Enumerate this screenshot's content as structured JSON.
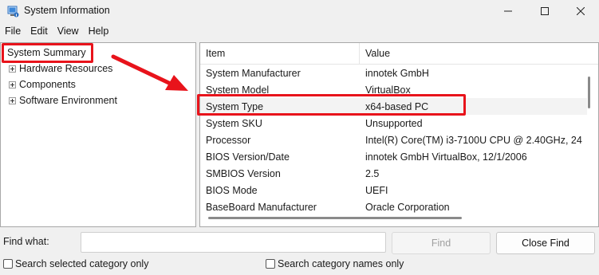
{
  "window": {
    "title": "System Information"
  },
  "menu": [
    "File",
    "Edit",
    "View",
    "Help"
  ],
  "tree": {
    "root": "System Summary",
    "children": [
      "Hardware Resources",
      "Components",
      "Software Environment"
    ]
  },
  "list": {
    "header_item": "Item",
    "header_value": "Value",
    "rows": [
      {
        "item": "System Manufacturer",
        "value": "innotek GmbH"
      },
      {
        "item": "System Model",
        "value": "VirtualBox"
      },
      {
        "item": "System Type",
        "value": "x64-based PC"
      },
      {
        "item": "System SKU",
        "value": "Unsupported"
      },
      {
        "item": "Processor",
        "value": "Intel(R) Core(TM) i3-7100U CPU @ 2.40GHz, 24"
      },
      {
        "item": "BIOS Version/Date",
        "value": "innotek GmbH VirtualBox, 12/1/2006"
      },
      {
        "item": "SMBIOS Version",
        "value": "2.5"
      },
      {
        "item": "BIOS Mode",
        "value": "UEFI"
      },
      {
        "item": "BaseBoard Manufacturer",
        "value": "Oracle Corporation"
      }
    ]
  },
  "find": {
    "label": "Find what:",
    "value": "",
    "find_button": "Find",
    "close_button": "Close Find",
    "check_selected": "Search selected category only",
    "check_names": "Search category names only"
  },
  "colors": {
    "annotation": "#e8131b",
    "background": "#f0f0f0"
  },
  "icons": [
    "system-information-app-icon",
    "minimize-icon",
    "maximize-icon",
    "close-icon",
    "expand-plus-icon"
  ]
}
